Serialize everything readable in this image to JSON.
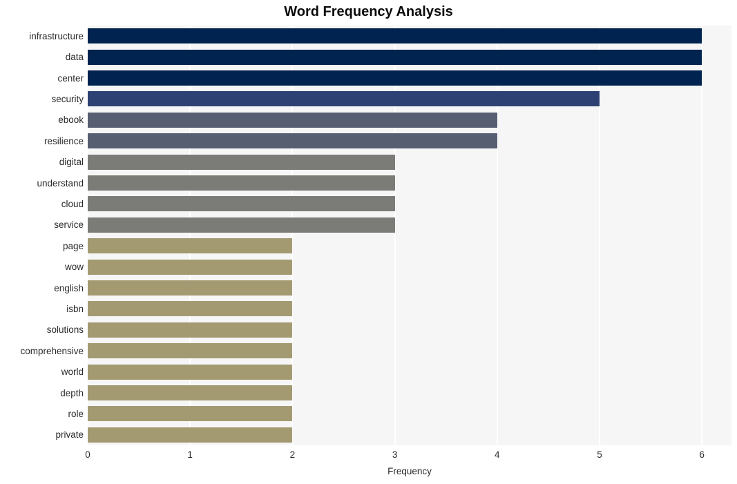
{
  "chart_data": {
    "type": "bar",
    "orientation": "horizontal",
    "title": "Word Frequency Analysis",
    "xlabel": "Frequency",
    "ylabel": "",
    "categories": [
      "infrastructure",
      "data",
      "center",
      "security",
      "ebook",
      "resilience",
      "digital",
      "understand",
      "cloud",
      "service",
      "page",
      "wow",
      "english",
      "isbn",
      "solutions",
      "comprehensive",
      "world",
      "depth",
      "role",
      "private"
    ],
    "values": [
      6,
      6,
      6,
      5,
      4,
      4,
      3,
      3,
      3,
      3,
      2,
      2,
      2,
      2,
      2,
      2,
      2,
      2,
      2,
      2
    ],
    "bar_colors": [
      "#00234f",
      "#00234f",
      "#00234f",
      "#2d4272",
      "#575e72",
      "#575e72",
      "#7b7b77",
      "#7b7b77",
      "#7b7b77",
      "#7b7b77",
      "#a39a72",
      "#a39a72",
      "#a39a72",
      "#a39a72",
      "#a39a72",
      "#a39a72",
      "#a39a72",
      "#a39a72",
      "#a39a72",
      "#a39a72"
    ],
    "xlim": [
      0,
      6.3
    ],
    "xticks": [
      0,
      1,
      2,
      3,
      4,
      5,
      6
    ],
    "xtick_labels": [
      "0",
      "1",
      "2",
      "3",
      "4",
      "5",
      "6"
    ],
    "grid": true,
    "grid_axis": "x",
    "grid_color": "#ffffff",
    "plot_background": "#f6f6f7",
    "figure_background": "#ffffff",
    "legend": null
  }
}
